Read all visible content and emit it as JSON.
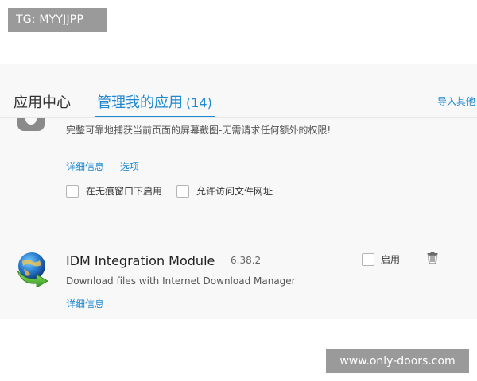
{
  "watermarks": {
    "top_left": "TG: MYYJJPP",
    "bottom_right": "www.only-doors.com"
  },
  "tabs": {
    "app_center": "应用中心",
    "my_apps": "管理我的应用",
    "my_apps_count": "(14)",
    "import_link": "导入其他"
  },
  "ext1": {
    "description": "完整可靠地捕获当前页面的屏幕截图-无需请求任何额外的权限!",
    "details_link": "详细信息",
    "options_link": "选项",
    "incognito_label": "在无痕窗口下启用",
    "file_access_label": "允许访问文件网址",
    "incognito_checked": false,
    "file_access_checked": false
  },
  "ext2": {
    "name": "IDM Integration Module",
    "version": "6.38.2",
    "enable_label": "启用",
    "enabled": false,
    "description": "Download files with Internet Download Manager",
    "details_link": "详细信息"
  },
  "colors": {
    "accent": "#1e88d0",
    "panel_bg": "#f8f8f8"
  },
  "icons": {
    "ext1_icon": "camera-icon",
    "ext2_icon": "idm-globe-icon",
    "remove": "trash-icon"
  }
}
